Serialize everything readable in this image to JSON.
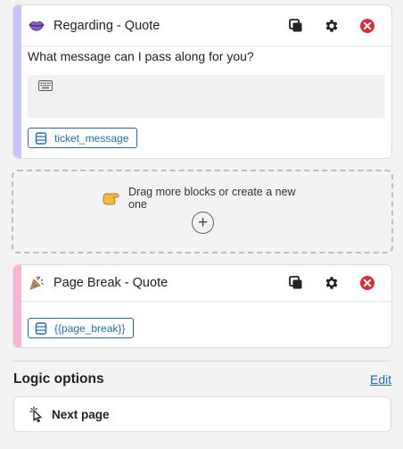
{
  "blocks": [
    {
      "title": "Regarding - Quote",
      "icon": "lips-icon",
      "accent_color": "#c7c4f7",
      "question": "What message can I pass along for you?",
      "variable": "ticket_message"
    },
    {
      "title": "Page Break - Quote",
      "icon": "party-popper-icon",
      "accent_color": "#f6b7d6",
      "variable": "{{page_break}}"
    }
  ],
  "dropzone": {
    "text": "Drag more blocks or create a new one",
    "plus_label": "+"
  },
  "logic": {
    "title": "Logic options",
    "edit_label": "Edit",
    "option_label": "Next page"
  },
  "colors": {
    "link": "#1d6fb5",
    "delete": "#d92d3a"
  }
}
